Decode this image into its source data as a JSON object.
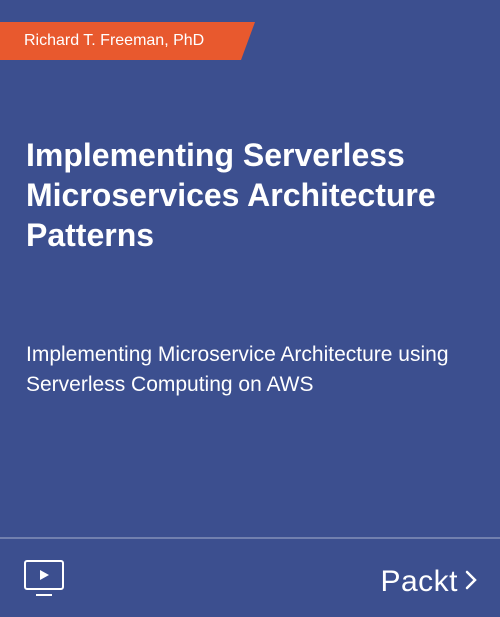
{
  "author": "Richard T. Freeman, PhD",
  "title": "Implementing Serverless Microservices Architecture Patterns",
  "subtitle": "Implementing Microservice Architecture using Serverless Computing on AWS",
  "brand": "Packt",
  "colors": {
    "background": "#3c4f8f",
    "accent": "#e8592e",
    "text": "#ffffff"
  }
}
